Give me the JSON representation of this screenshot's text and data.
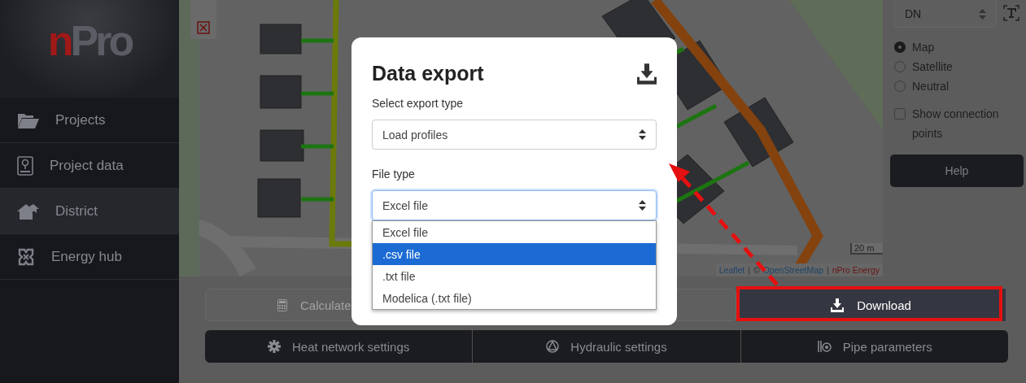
{
  "sidebar": {
    "logo": {
      "accent": "n",
      "text": "Pro"
    },
    "items": [
      {
        "label": "Projects",
        "selected": false
      },
      {
        "label": "Project data",
        "selected": false
      },
      {
        "label": "District",
        "selected": true
      },
      {
        "label": "Energy hub",
        "selected": false
      }
    ]
  },
  "map": {
    "scale": "20 m",
    "attribution": [
      {
        "text": "Leaflet",
        "kind": "link"
      },
      {
        "text": "|",
        "kind": "sep"
      },
      {
        "text": "©",
        "kind": "text"
      },
      {
        "text": "OpenStreetMap",
        "kind": "link"
      },
      {
        "text": "|",
        "kind": "sep"
      },
      {
        "text": "nPro Energy",
        "kind": "brand"
      }
    ]
  },
  "right_panel": {
    "label_select": {
      "value": "DN"
    },
    "layers": [
      {
        "label": "Map",
        "selected": true
      },
      {
        "label": "Satellite",
        "selected": false
      },
      {
        "label": "Neutral",
        "selected": false
      }
    ],
    "connection_points": {
      "label": "Show connection points",
      "checked": false
    },
    "help": "Help"
  },
  "actions": [
    {
      "label": "Calculate",
      "disabled": true
    },
    {
      "label": "Download",
      "disabled": false
    }
  ],
  "tabs": [
    {
      "label": "Heat network settings"
    },
    {
      "label": "Hydraulic settings"
    },
    {
      "label": "Pipe parameters"
    }
  ],
  "modal": {
    "title": "Data export",
    "export_type": {
      "label": "Select export type",
      "value": "Load profiles"
    },
    "file_type": {
      "label": "File type",
      "value": "Excel file",
      "expanded": true,
      "options": [
        {
          "label": "Excel file",
          "highlighted": false
        },
        {
          "label": ".csv file",
          "highlighted": true
        },
        {
          "label": ".txt file",
          "highlighted": false
        },
        {
          "label": "Modelica (.txt file)",
          "highlighted": false
        }
      ]
    }
  }
}
